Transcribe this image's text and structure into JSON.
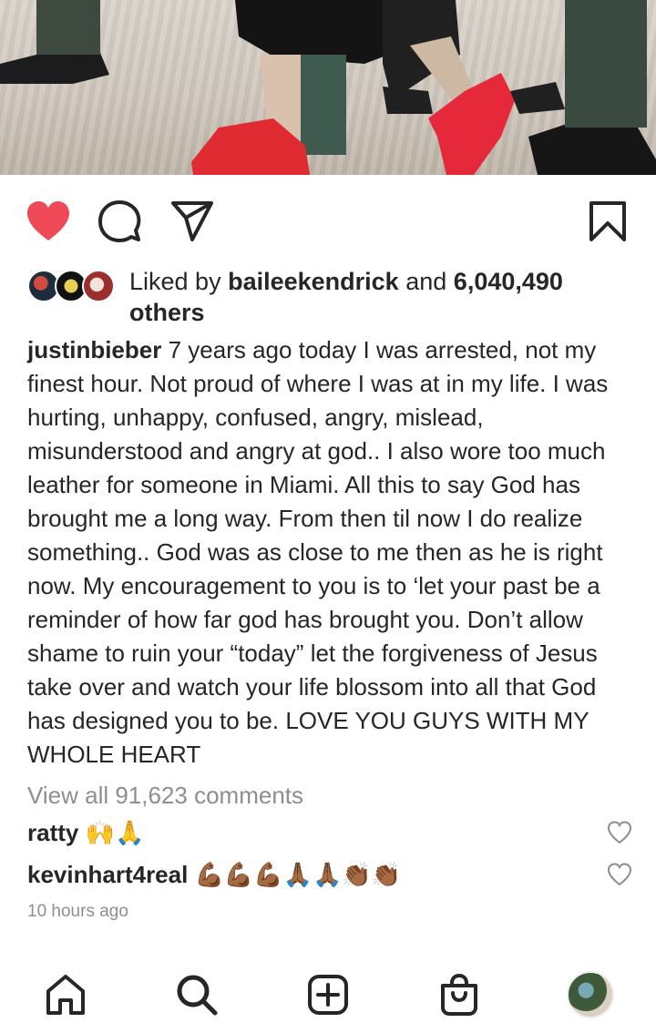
{
  "post": {
    "likes": {
      "prefix": "Liked by",
      "user": "baileekendrick",
      "and": "and",
      "count": "6,040,490",
      "suffix": "others"
    },
    "caption": {
      "username": "justinbieber",
      "text": "7 years ago today I was arrested, not my finest hour. Not proud of where I was at in my life. I was hurting, unhappy, confused, angry, mislead, misunderstood and angry at god.. I also wore too much leather for someone in Miami. All this to say God has brought me a long way. From then til now I do realize something.. God was as close to me then as he is right now. My encouragement to you is to ‘let your past be a reminder of how far god has brought you. Don’t allow shame to ruin your “today” let the forgiveness of Jesus take over and watch your life blossom into all that God has designed you to be. LOVE YOU GUYS WITH MY WHOLE HEART"
    },
    "view_all": "View all 91,623 comments",
    "comments": [
      {
        "user": "ratty",
        "text": "🙌🙏"
      },
      {
        "user": "kevinhart4real",
        "text": "💪🏾💪🏾💪🏾🙏🏾🙏🏾👏🏾👏🏾"
      }
    ],
    "timestamp": "10 hours ago",
    "liked": true
  },
  "icons": {
    "like": "heart-icon",
    "comment": "comment-icon",
    "share": "paper-plane-icon",
    "save": "bookmark-icon",
    "comment_like": "heart-outline-icon"
  },
  "nav": [
    "home-icon",
    "search-icon",
    "add-post-icon",
    "shop-bag-icon",
    "profile-avatar"
  ],
  "colors": {
    "like_red": "#ed4956",
    "text": "#262626",
    "muted": "#8e8e8e"
  }
}
